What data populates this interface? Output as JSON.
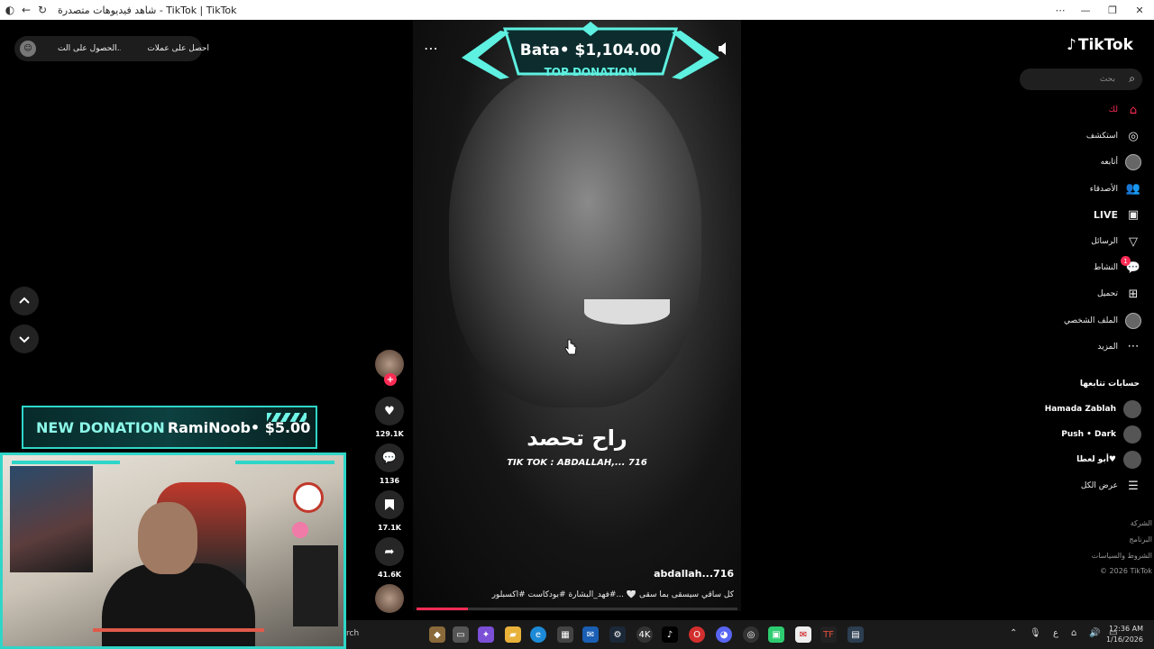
{
  "window": {
    "title": "شاهد فيديوهات متصدرة - TikTok | TikTok"
  },
  "top_pill": {
    "item1": "الحصول على الت...",
    "item2": "احصل على عملات"
  },
  "video": {
    "banner_amount": "Bata• $1,104.00",
    "banner_label": "TOP DONATION",
    "caption_big": "راح تحصد",
    "caption_small": "TIK TOK : ABDALLAH,... 716",
    "author": "abdallah...716",
    "description": "كل ساقي سيسقى بما سقى 🤍 ...#فهد_البشارة #بودكاست #اكسبلور",
    "progress": 0.16,
    "more_icon": "⋯"
  },
  "actions": {
    "plus": "+",
    "likes": "129.1K",
    "comments": "1136",
    "saves": "17.1K",
    "shares": "41.6K"
  },
  "nav": {
    "up_icon": "chevron-up",
    "down_icon": "chevron-down"
  },
  "sidebar": {
    "logo_text": "TikTok",
    "search_placeholder": "بحث",
    "items": [
      {
        "label": "لك",
        "icon": "home",
        "active": true
      },
      {
        "label": "استكشف",
        "icon": "compass"
      },
      {
        "label": "أتابعه",
        "icon": "following-avatar"
      },
      {
        "label": "الأصدقاء",
        "icon": "friends"
      },
      {
        "label": "LIVE",
        "icon": "live"
      },
      {
        "label": "الرسائل",
        "icon": "messages"
      },
      {
        "label": "النشاط",
        "icon": "activity",
        "badge": "1"
      },
      {
        "label": "تحميل",
        "icon": "upload"
      },
      {
        "label": "الملف الشخصي",
        "icon": "profile"
      },
      {
        "label": "المزيد",
        "icon": "more"
      }
    ],
    "following_title": "حسابات تتابعها",
    "following": [
      {
        "name": "Hamada Zablah"
      },
      {
        "name": "Push • Dark"
      },
      {
        "name": "أبو لعطا♥"
      }
    ],
    "see_all": "عرض الكل",
    "footer": [
      "الشركة",
      "البرنامج",
      "الشروط والسياسات",
      "© 2026 TikTok"
    ]
  },
  "overlay": {
    "donation_label": "NEW DONATION",
    "donation_value": "RamiNoob• $5.00"
  },
  "taskbar": {
    "search_text": "rch",
    "clock_time": "12:36 AM",
    "clock_date": "1/16/2026",
    "lang": "ع"
  },
  "colors": {
    "accent": "#fe2c55",
    "teal": "#2fd6c8"
  }
}
